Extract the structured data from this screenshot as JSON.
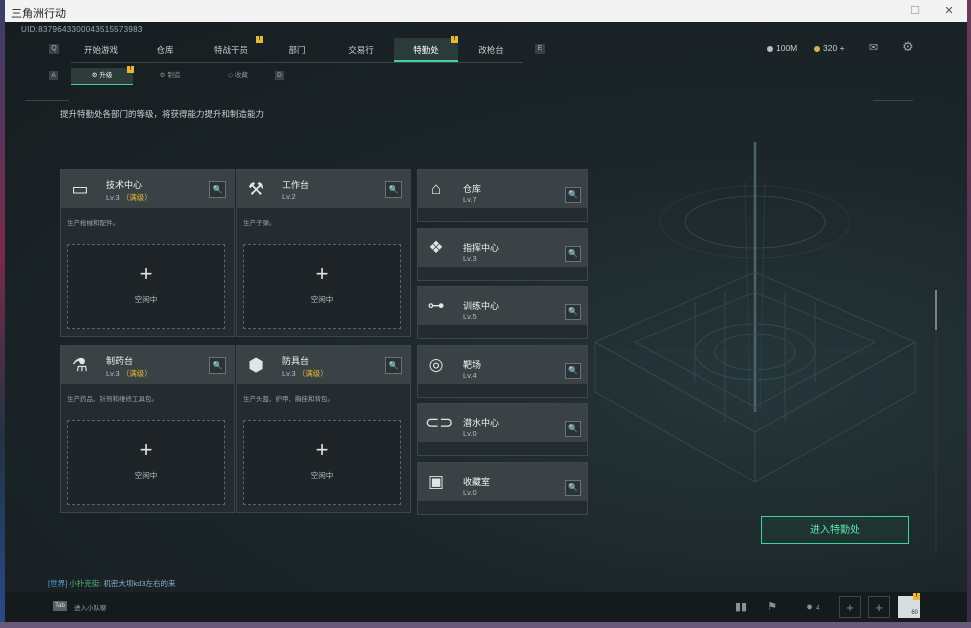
{
  "window": {
    "title": "三角洲行动"
  },
  "uid": "UID:8379643300043515573983",
  "nav": {
    "left_key": "Q",
    "right_key": "E",
    "tabs": [
      {
        "label": "开始游戏"
      },
      {
        "label": "仓库"
      },
      {
        "label": "特战干员",
        "badge": "!"
      },
      {
        "label": "部门"
      },
      {
        "label": "交易行"
      },
      {
        "label": "特勤处",
        "badge": "!",
        "active": true
      },
      {
        "label": "改枪台"
      }
    ]
  },
  "resources": {
    "coin1": "100M",
    "coin2": "320",
    "coin2_plus": "+"
  },
  "subnav": {
    "left_key": "A",
    "right_key": "D",
    "tabs": [
      {
        "label": "升级",
        "badge": "!",
        "active": true
      },
      {
        "label": "制造"
      },
      {
        "label": "收藏"
      }
    ]
  },
  "description": "提升特勤处各部门的等级，将获得能力提升和制造能力",
  "facilities": [
    {
      "name": "技术中心",
      "level": "Lv.3",
      "max": "（满级）",
      "desc": "生产枪械和配件。",
      "slot_status": "空闲中",
      "icon": "computer-icon"
    },
    {
      "name": "工作台",
      "level": "Lv.2",
      "max": "",
      "desc": "生产子弹。",
      "slot_status": "空闲中",
      "icon": "tools-icon"
    },
    {
      "name": "制药台",
      "level": "Lv.3",
      "max": "（满级）",
      "desc": "生产药品、针剂和维修工具包。",
      "slot_status": "空闲中",
      "icon": "microscope-icon"
    },
    {
      "name": "防具台",
      "level": "Lv.3",
      "max": "（满级）",
      "desc": "生产头盔、护甲、胸挂和背包。",
      "slot_status": "空闲中",
      "icon": "armor-icon"
    }
  ],
  "departments": [
    {
      "name": "仓库",
      "level": "Lv.7",
      "icon": "warehouse-icon"
    },
    {
      "name": "指挥中心",
      "level": "Lv.3",
      "icon": "chip-icon"
    },
    {
      "name": "训练中心",
      "level": "Lv.5",
      "icon": "dumbbell-icon"
    },
    {
      "name": "靶场",
      "level": "Lv.4",
      "icon": "target-icon"
    },
    {
      "name": "潜水中心",
      "level": "Lv.0",
      "icon": "diving-mask-icon"
    },
    {
      "name": "收藏室",
      "level": "Lv.0",
      "icon": "display-case-icon"
    }
  ],
  "enter_button": "进入特勤处",
  "chat": {
    "channel": "[世界]",
    "user": "小扑克街",
    "message": "机密大坝kd3左右的来"
  },
  "footer": {
    "tab_key": "Tab",
    "tab_hint": "进入小队聊",
    "friends_count": "4",
    "level": "60",
    "avatar_badge": "!"
  },
  "colors": {
    "accent": "#3ed39a",
    "badge": "#e6b835",
    "max_level": "#e6b835"
  }
}
